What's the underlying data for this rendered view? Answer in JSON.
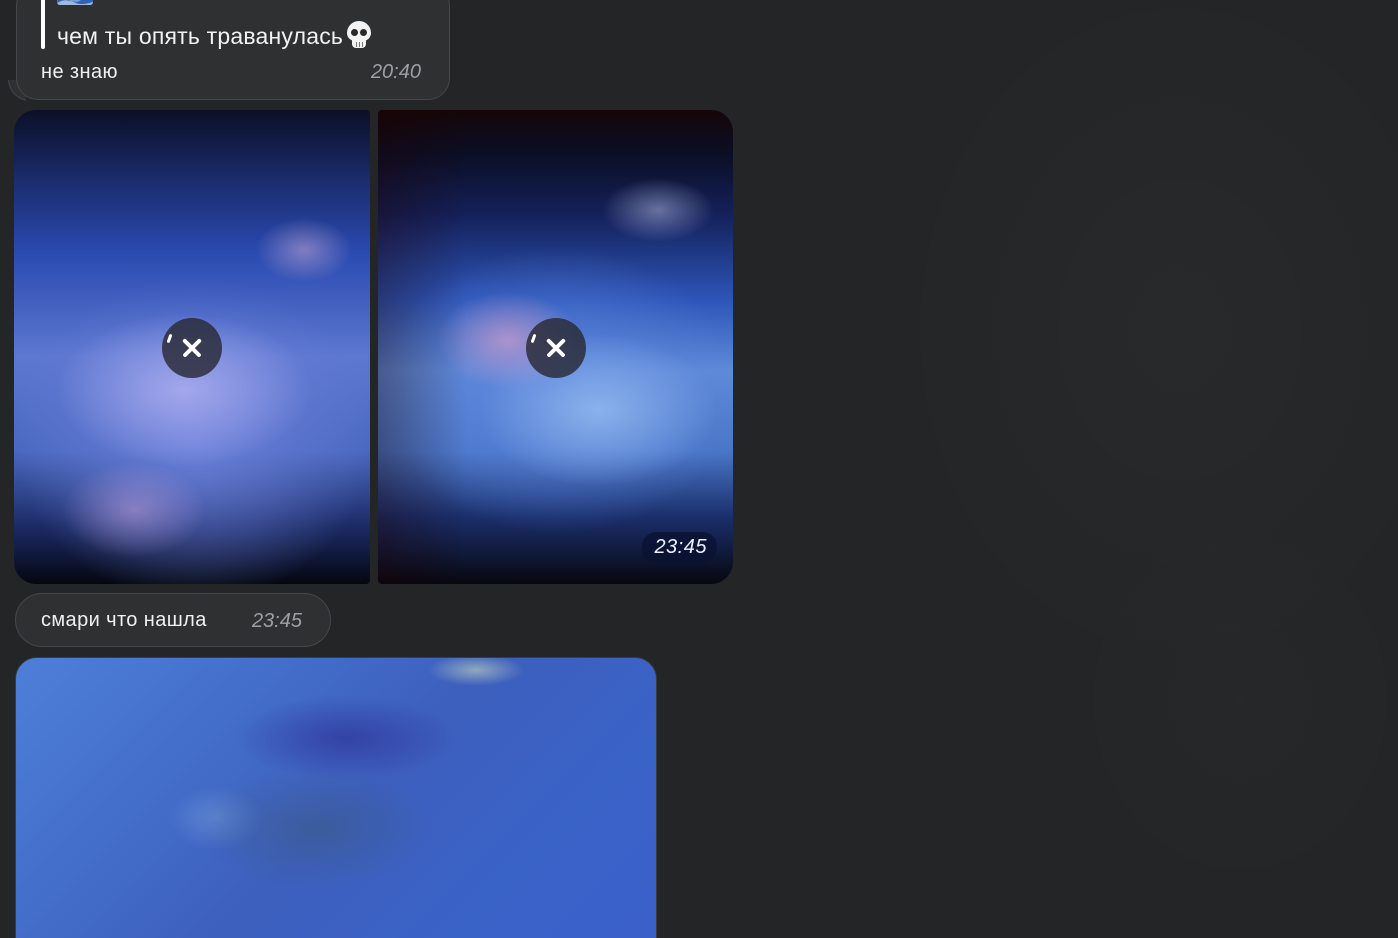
{
  "reply_message": {
    "quoted_emoji": "wave-emoji",
    "quoted_text": "чем ты опять траванулась",
    "quoted_emoji_end": "skull-emoji",
    "text": "не знаю",
    "time": "20:40"
  },
  "photo_album": {
    "photos": [
      {
        "icon": "cancel-download-icon"
      },
      {
        "icon": "cancel-download-icon"
      }
    ],
    "time": "23:45"
  },
  "text_message": {
    "text": "смари что нашла",
    "time": "23:45"
  },
  "colors": {
    "background": "#232527",
    "bubble": "#2e3032",
    "bubble_border": "#45484b",
    "text": "#f0f0f0",
    "time": "#9aa0a6"
  }
}
